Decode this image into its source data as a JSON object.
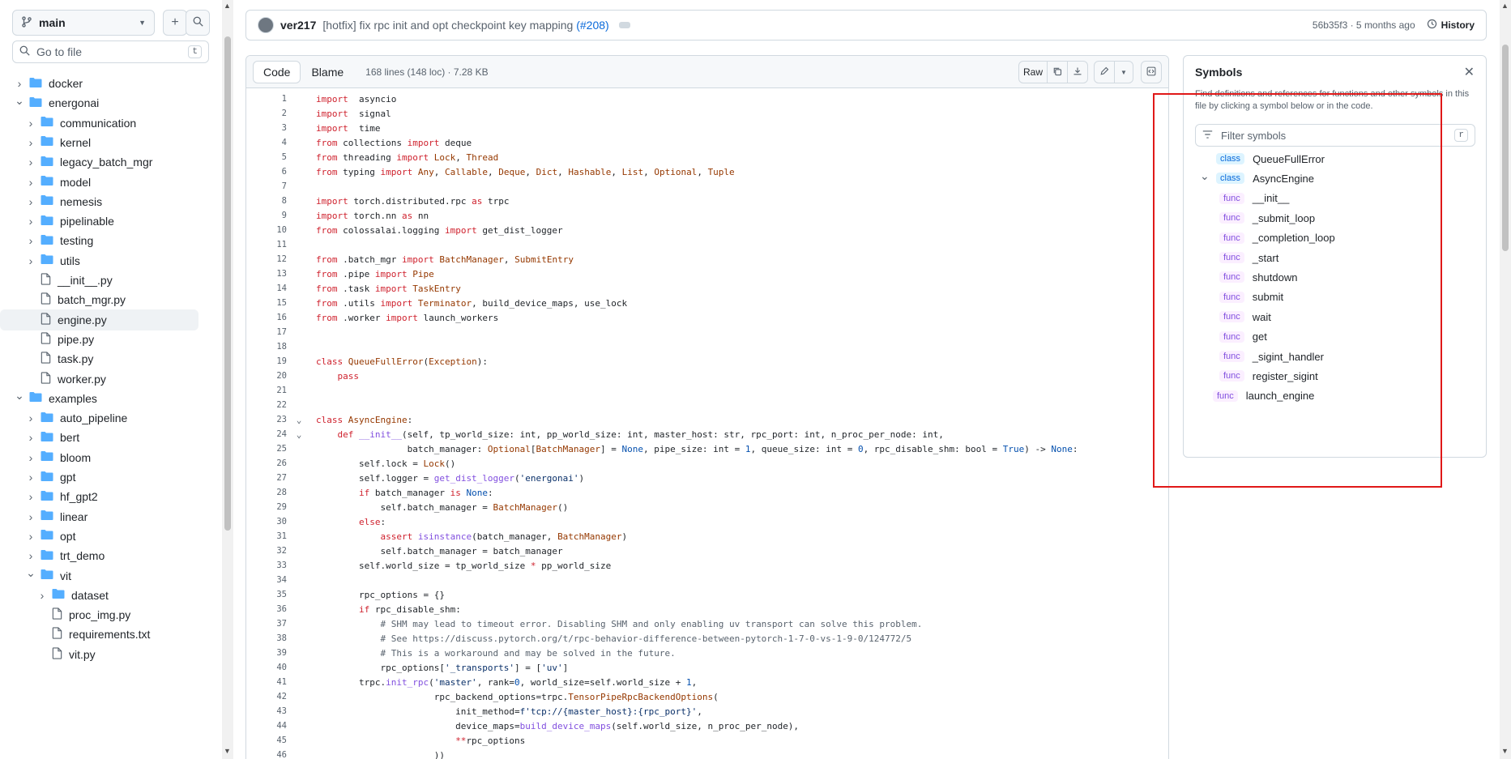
{
  "sidebar": {
    "branch": "main",
    "goto_placeholder": "Go to file",
    "goto_shortcut": "t",
    "tree": [
      {
        "name": "docker",
        "type": "folder",
        "expanded": false,
        "depth": 0
      },
      {
        "name": "energonai",
        "type": "folder",
        "expanded": true,
        "depth": 0
      },
      {
        "name": "communication",
        "type": "folder",
        "expanded": false,
        "depth": 1
      },
      {
        "name": "kernel",
        "type": "folder",
        "expanded": false,
        "depth": 1
      },
      {
        "name": "legacy_batch_mgr",
        "type": "folder",
        "expanded": false,
        "depth": 1
      },
      {
        "name": "model",
        "type": "folder",
        "expanded": false,
        "depth": 1
      },
      {
        "name": "nemesis",
        "type": "folder",
        "expanded": false,
        "depth": 1
      },
      {
        "name": "pipelinable",
        "type": "folder",
        "expanded": false,
        "depth": 1
      },
      {
        "name": "testing",
        "type": "folder",
        "expanded": false,
        "depth": 1
      },
      {
        "name": "utils",
        "type": "folder",
        "expanded": false,
        "depth": 1
      },
      {
        "name": "__init__.py",
        "type": "file",
        "depth": 1
      },
      {
        "name": "batch_mgr.py",
        "type": "file",
        "depth": 1
      },
      {
        "name": "engine.py",
        "type": "file",
        "depth": 1,
        "selected": true
      },
      {
        "name": "pipe.py",
        "type": "file",
        "depth": 1
      },
      {
        "name": "task.py",
        "type": "file",
        "depth": 1
      },
      {
        "name": "worker.py",
        "type": "file",
        "depth": 1
      },
      {
        "name": "examples",
        "type": "folder",
        "expanded": true,
        "depth": 0
      },
      {
        "name": "auto_pipeline",
        "type": "folder",
        "expanded": false,
        "depth": 1
      },
      {
        "name": "bert",
        "type": "folder",
        "expanded": false,
        "depth": 1
      },
      {
        "name": "bloom",
        "type": "folder",
        "expanded": false,
        "depth": 1
      },
      {
        "name": "gpt",
        "type": "folder",
        "expanded": false,
        "depth": 1
      },
      {
        "name": "hf_gpt2",
        "type": "folder",
        "expanded": false,
        "depth": 1
      },
      {
        "name": "linear",
        "type": "folder",
        "expanded": false,
        "depth": 1
      },
      {
        "name": "opt",
        "type": "folder",
        "expanded": false,
        "depth": 1
      },
      {
        "name": "trt_demo",
        "type": "folder",
        "expanded": false,
        "depth": 1
      },
      {
        "name": "vit",
        "type": "folder",
        "expanded": true,
        "depth": 1
      },
      {
        "name": "dataset",
        "type": "folder",
        "expanded": false,
        "depth": 2
      },
      {
        "name": "proc_img.py",
        "type": "file",
        "depth": 2
      },
      {
        "name": "requirements.txt",
        "type": "file",
        "depth": 2
      },
      {
        "name": "vit.py",
        "type": "file",
        "depth": 2
      }
    ]
  },
  "commit": {
    "author": "ver217",
    "message": "[hotfix] fix rpc init and opt checkpoint key mapping",
    "pr": "(#208)",
    "meta": "56b35f3 · 5 months ago",
    "history_label": "History"
  },
  "code_header": {
    "tab_code": "Code",
    "tab_blame": "Blame",
    "file_info": "168 lines (148 loc) · 7.28 KB",
    "raw_label": "Raw"
  },
  "code_lines": [
    [
      [
        "kw",
        "import"
      ],
      [
        "",
        "  asyncio"
      ]
    ],
    [
      [
        "kw",
        "import"
      ],
      [
        "",
        "  signal"
      ]
    ],
    [
      [
        "kw",
        "import"
      ],
      [
        "",
        "  time"
      ]
    ],
    [
      [
        "kw",
        "from"
      ],
      [
        "",
        " collections "
      ],
      [
        "kw",
        "import"
      ],
      [
        "",
        " deque"
      ]
    ],
    [
      [
        "kw",
        "from"
      ],
      [
        "",
        " threading "
      ],
      [
        "kw",
        "import"
      ],
      [
        "",
        " "
      ],
      [
        "cls",
        "Lock"
      ],
      [
        "",
        ", "
      ],
      [
        "cls",
        "Thread"
      ]
    ],
    [
      [
        "kw",
        "from"
      ],
      [
        "",
        " typing "
      ],
      [
        "kw",
        "import"
      ],
      [
        "",
        " "
      ],
      [
        "cls",
        "Any"
      ],
      [
        "",
        ", "
      ],
      [
        "cls",
        "Callable"
      ],
      [
        "",
        ", "
      ],
      [
        "cls",
        "Deque"
      ],
      [
        "",
        ", "
      ],
      [
        "cls",
        "Dict"
      ],
      [
        "",
        ", "
      ],
      [
        "cls",
        "Hashable"
      ],
      [
        "",
        ", "
      ],
      [
        "cls",
        "List"
      ],
      [
        "",
        ", "
      ],
      [
        "cls",
        "Optional"
      ],
      [
        "",
        ", "
      ],
      [
        "cls",
        "Tuple"
      ]
    ],
    [],
    [
      [
        "kw",
        "import"
      ],
      [
        "",
        " torch.distributed.rpc "
      ],
      [
        "kw",
        "as"
      ],
      [
        "",
        " trpc"
      ]
    ],
    [
      [
        "kw",
        "import"
      ],
      [
        "",
        " torch.nn "
      ],
      [
        "kw",
        "as"
      ],
      [
        "",
        " nn"
      ]
    ],
    [
      [
        "kw",
        "from"
      ],
      [
        "",
        " colossalai.logging "
      ],
      [
        "kw",
        "import"
      ],
      [
        "",
        " get_dist_logger"
      ]
    ],
    [],
    [
      [
        "kw",
        "from"
      ],
      [
        "",
        " .batch_mgr "
      ],
      [
        "kw",
        "import"
      ],
      [
        "",
        " "
      ],
      [
        "cls",
        "BatchManager"
      ],
      [
        "",
        ", "
      ],
      [
        "cls",
        "SubmitEntry"
      ]
    ],
    [
      [
        "kw",
        "from"
      ],
      [
        "",
        " .pipe "
      ],
      [
        "kw",
        "import"
      ],
      [
        "",
        " "
      ],
      [
        "cls",
        "Pipe"
      ]
    ],
    [
      [
        "kw",
        "from"
      ],
      [
        "",
        " .task "
      ],
      [
        "kw",
        "import"
      ],
      [
        "",
        " "
      ],
      [
        "cls",
        "TaskEntry"
      ]
    ],
    [
      [
        "kw",
        "from"
      ],
      [
        "",
        " .utils "
      ],
      [
        "kw",
        "import"
      ],
      [
        "",
        " "
      ],
      [
        "cls",
        "Terminator"
      ],
      [
        "",
        ", build_device_maps, use_lock"
      ]
    ],
    [
      [
        "kw",
        "from"
      ],
      [
        "",
        " .worker "
      ],
      [
        "kw",
        "import"
      ],
      [
        "",
        " launch_workers"
      ]
    ],
    [],
    [],
    [
      [
        "kw",
        "class"
      ],
      [
        "",
        " "
      ],
      [
        "cls",
        "QueueFullError"
      ],
      [
        "",
        "("
      ],
      [
        "cls",
        "Exception"
      ],
      [
        "",
        "):"
      ]
    ],
    [
      [
        "",
        "    "
      ],
      [
        "kw",
        "pass"
      ]
    ],
    [],
    [],
    [
      [
        "kw",
        "class"
      ],
      [
        "",
        " "
      ],
      [
        "cls",
        "AsyncEngine"
      ],
      [
        "",
        ":"
      ]
    ],
    [
      [
        "",
        "    "
      ],
      [
        "kw",
        "def"
      ],
      [
        "",
        " "
      ],
      [
        "fn",
        "__init__"
      ],
      [
        "",
        "(self, tp_world_size: int, pp_world_size: int, master_host: str, rpc_port: int, n_proc_per_node: int,"
      ]
    ],
    [
      [
        "",
        "                 batch_manager: "
      ],
      [
        "cls",
        "Optional"
      ],
      [
        "",
        "["
      ],
      [
        "cls",
        "BatchManager"
      ],
      [
        "",
        "] = "
      ],
      [
        "bl",
        "None"
      ],
      [
        "",
        ", pipe_size: int = "
      ],
      [
        "num",
        "1"
      ],
      [
        "",
        ", queue_size: int = "
      ],
      [
        "num",
        "0"
      ],
      [
        "",
        ", rpc_disable_shm: bool = "
      ],
      [
        "bl",
        "True"
      ],
      [
        "",
        ") -> "
      ],
      [
        "bl",
        "None"
      ],
      [
        "",
        ":"
      ]
    ],
    [
      [
        "",
        "        self.lock = "
      ],
      [
        "cls",
        "Lock"
      ],
      [
        "",
        "()"
      ]
    ],
    [
      [
        "",
        "        self.logger = "
      ],
      [
        "fn",
        "get_dist_logger"
      ],
      [
        "",
        "("
      ],
      [
        "str",
        "'energonai'"
      ],
      [
        "",
        ")"
      ]
    ],
    [
      [
        "",
        "        "
      ],
      [
        "kw",
        "if"
      ],
      [
        "",
        " batch_manager "
      ],
      [
        "kw",
        "is"
      ],
      [
        "",
        " "
      ],
      [
        "bl",
        "None"
      ],
      [
        "",
        ":"
      ]
    ],
    [
      [
        "",
        "            self.batch_manager = "
      ],
      [
        "cls",
        "BatchManager"
      ],
      [
        "",
        "()"
      ]
    ],
    [
      [
        "",
        "        "
      ],
      [
        "kw",
        "else"
      ],
      [
        "",
        ":"
      ]
    ],
    [
      [
        "",
        "            "
      ],
      [
        "kw",
        "assert"
      ],
      [
        "",
        " "
      ],
      [
        "fn",
        "isinstance"
      ],
      [
        "",
        "(batch_manager, "
      ],
      [
        "cls",
        "BatchManager"
      ],
      [
        "",
        ")"
      ]
    ],
    [
      [
        "",
        "            self.batch_manager = batch_manager"
      ]
    ],
    [
      [
        "",
        "        self.world_size = tp_world_size "
      ],
      [
        "kw",
        "*"
      ],
      [
        "",
        " pp_world_size"
      ]
    ],
    [],
    [
      [
        "",
        "        rpc_options = {}"
      ]
    ],
    [
      [
        "",
        "        "
      ],
      [
        "kw",
        "if"
      ],
      [
        "",
        " rpc_disable_shm:"
      ]
    ],
    [
      [
        "",
        "            "
      ],
      [
        "cm",
        "# SHM may lead to timeout error. Disabling SHM and only enabling uv transport can solve this problem."
      ]
    ],
    [
      [
        "",
        "            "
      ],
      [
        "cm",
        "# See https://discuss.pytorch.org/t/rpc-behavior-difference-between-pytorch-1-7-0-vs-1-9-0/124772/5"
      ]
    ],
    [
      [
        "",
        "            "
      ],
      [
        "cm",
        "# This is a workaround and may be solved in the future."
      ]
    ],
    [
      [
        "",
        "            rpc_options["
      ],
      [
        "str",
        "'_transports'"
      ],
      [
        "",
        "] = ["
      ],
      [
        "str",
        "'uv'"
      ],
      [
        "",
        "]"
      ]
    ],
    [
      [
        "",
        "        trpc."
      ],
      [
        "fn",
        "init_rpc"
      ],
      [
        "",
        "("
      ],
      [
        "str",
        "'master'"
      ],
      [
        "",
        ", rank="
      ],
      [
        "num",
        "0"
      ],
      [
        "",
        ", world_size=self.world_size + "
      ],
      [
        "num",
        "1"
      ],
      [
        "",
        ","
      ]
    ],
    [
      [
        "",
        "                      rpc_backend_options=trpc."
      ],
      [
        "cls",
        "TensorPipeRpcBackendOptions"
      ],
      [
        "",
        "("
      ]
    ],
    [
      [
        "",
        "                          init_method="
      ],
      [
        "str",
        "f'tcp://{master_host}:{rpc_port}'"
      ],
      [
        "",
        ","
      ]
    ],
    [
      [
        "",
        "                          device_maps="
      ],
      [
        "fn",
        "build_device_maps"
      ],
      [
        "",
        "(self.world_size, n_proc_per_node),"
      ]
    ],
    [
      [
        "",
        "                          "
      ],
      [
        "kw",
        "**"
      ],
      [
        "",
        "rpc_options"
      ]
    ],
    [
      [
        "",
        "                      ))"
      ]
    ]
  ],
  "symbols": {
    "title": "Symbols",
    "description": "Find definitions and references for functions and other symbols in this file by clicking a symbol below or in the code.",
    "filter_placeholder": "Filter symbols",
    "filter_shortcut": "r",
    "items": [
      {
        "kind": "class",
        "name": "QueueFullError",
        "depth": 0
      },
      {
        "kind": "class",
        "name": "AsyncEngine",
        "depth": 0,
        "expanded": true
      },
      {
        "kind": "func",
        "name": "__init__",
        "depth": 1
      },
      {
        "kind": "func",
        "name": "_submit_loop",
        "depth": 1
      },
      {
        "kind": "func",
        "name": "_completion_loop",
        "depth": 1
      },
      {
        "kind": "func",
        "name": "_start",
        "depth": 1
      },
      {
        "kind": "func",
        "name": "shutdown",
        "depth": 1
      },
      {
        "kind": "func",
        "name": "submit",
        "depth": 1
      },
      {
        "kind": "func",
        "name": "wait",
        "depth": 1
      },
      {
        "kind": "func",
        "name": "get",
        "depth": 1
      },
      {
        "kind": "func",
        "name": "_sigint_handler",
        "depth": 1
      },
      {
        "kind": "func",
        "name": "register_sigint",
        "depth": 1
      },
      {
        "kind": "func",
        "name": "launch_engine",
        "depth": 0
      }
    ]
  },
  "colors": {
    "accent": "#0969da",
    "highlight_box": "#e01818",
    "selected_row": "#eff2f5"
  }
}
